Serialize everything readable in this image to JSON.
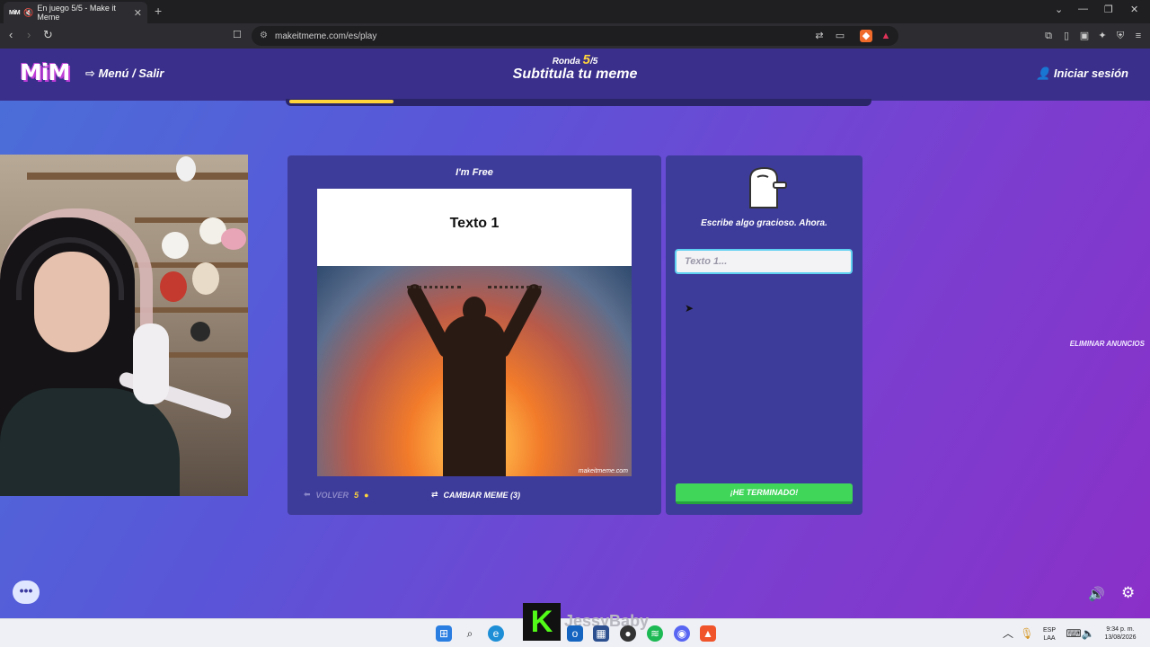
{
  "browser": {
    "tab_favicon": "MiM",
    "tab_title": "En juego 5/5 - Make it Meme",
    "tab_close": "✕",
    "new_tab": "+",
    "url": "makeitmeme.com/es/play"
  },
  "header": {
    "logo": "MiM",
    "menu_label": "Menú / Salir",
    "round_label": "Ronda",
    "round_current": "5",
    "round_total": "/5",
    "title": "Subtitula tu meme",
    "login_label": "Iniciar sesión",
    "progress_fraction": 0.18
  },
  "meme": {
    "name": "I'm Free",
    "text1": "Texto 1",
    "watermark": "makeitmeme.com"
  },
  "controls": {
    "back_label": "VOLVER",
    "coins": "5",
    "change_label": "CAMBIAR MEME (3)"
  },
  "write": {
    "prompt": "Escribe algo gracioso. Ahora.",
    "input_placeholder": "Texto 1...",
    "input_value": "",
    "done_label": "¡HE TERMINADO!"
  },
  "ads": {
    "remove_label": "ELIMINAR ANUNCIOS"
  },
  "taskbar": {
    "streamer_name": "JessyBaby",
    "lang_line1": "ESP",
    "lang_line2": "LAA",
    "time": "9:34 p. m.",
    "date": "13/08/2026"
  },
  "colors": {
    "accent_yellow": "#ffd43b",
    "done_green": "#3fd65a",
    "panel": "#3e3c9a",
    "header": "#3a2f8a"
  },
  "icons": [
    "menu-exit-icon",
    "user-icon",
    "back-arrow-icon",
    "coin-icon",
    "swap-icon",
    "chat-icon",
    "sound-icon",
    "gear-icon"
  ]
}
